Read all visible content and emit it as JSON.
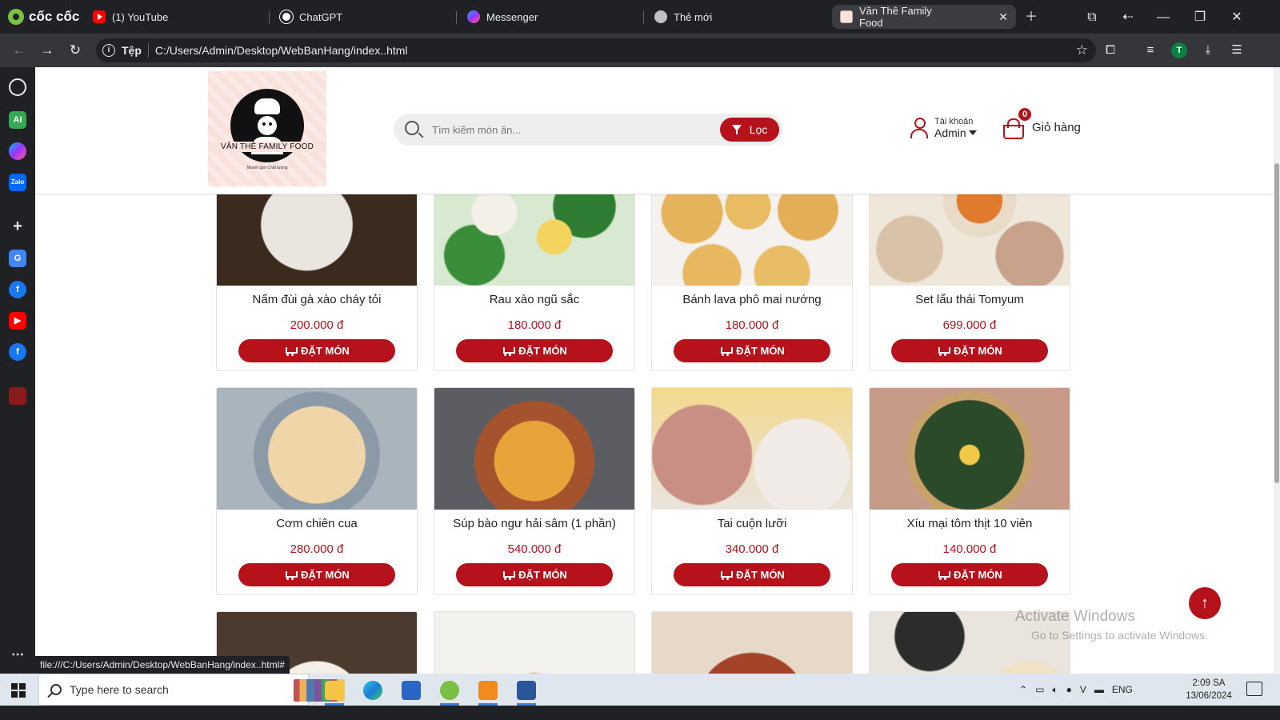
{
  "browser": {
    "brand": "cốc cốc",
    "tabs": [
      {
        "title": "(1) YouTube",
        "icon": "youtube-icon"
      },
      {
        "title": "ChatGPT",
        "icon": "chatgpt-icon"
      },
      {
        "title": "Messenger",
        "icon": "messenger-icon"
      },
      {
        "title": "Thẻ mới",
        "icon": "new-tab-icon"
      },
      {
        "title": "Văn Thê Family Food",
        "icon": "site-icon",
        "active": true
      }
    ],
    "address": {
      "scheme_label": "Tệp",
      "url": "C:/Users/Admin/Desktop/WebBanHang/index..html"
    },
    "profile_initial": "T",
    "status_url": "file:///C:/Users/Admin/Desktop/WebBanHang/index..html#"
  },
  "site": {
    "logo": {
      "name": "VĂN THÊ FAMILY FOOD",
      "tagline": "Nhanh gọn Chất lượng"
    },
    "search": {
      "placeholder": "Tìm kiếm món ăn...",
      "filter_label": "Lọc"
    },
    "account": {
      "label": "Tài khoản",
      "name": "Admin"
    },
    "cart": {
      "label": "Giỏ hàng",
      "count": "0"
    },
    "order_label": "ĐẶT MÓN",
    "products": [
      {
        "name": "Nấm đùi gà xào cháy tỏi",
        "price": "200.000 đ"
      },
      {
        "name": "Rau xào ngũ sắc",
        "price": "180.000 đ"
      },
      {
        "name": "Bánh lava phô mai nướng",
        "price": "180.000 đ"
      },
      {
        "name": "Set lẩu thái Tomyum",
        "price": "699.000 đ"
      },
      {
        "name": "Cơm chiên cua",
        "price": "280.000 đ"
      },
      {
        "name": "Súp bào ngư hải sâm (1 phần)",
        "price": "540.000 đ"
      },
      {
        "name": "Tai cuộn lưỡi",
        "price": "340.000 đ"
      },
      {
        "name": "Xíu mại tôm thịt 10 viên",
        "price": "140.000 đ"
      }
    ]
  },
  "watermark": {
    "title": "Activate Windows",
    "subtitle": "Go to Settings to activate Windows."
  },
  "taskbar": {
    "search_placeholder": "Type here to search",
    "language": "ENG",
    "time": "2:09 SA",
    "date": "13/06/2024"
  },
  "colors": {
    "accent": "#b5121b",
    "browser_dark": "#202124"
  }
}
